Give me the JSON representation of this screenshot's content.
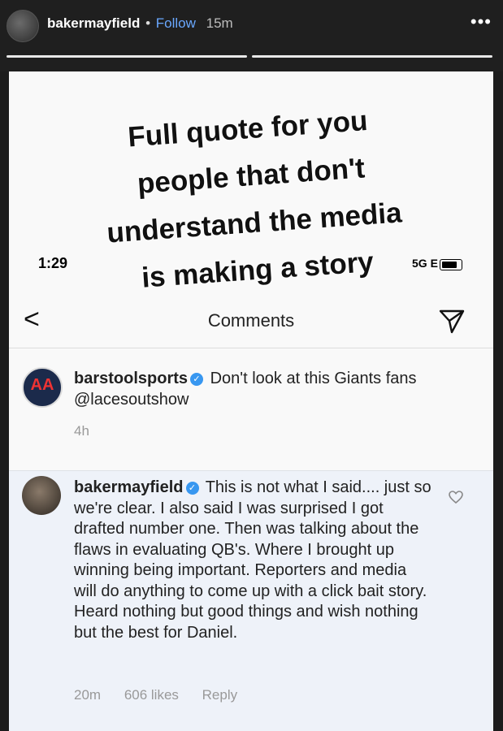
{
  "story": {
    "username": "bakermayfield",
    "separator": "•",
    "follow_label": "Follow",
    "time": "15m",
    "more_label": "•••"
  },
  "overlay": {
    "line1": "Full quote for you",
    "line2": "people that don't",
    "line3": "understand the media",
    "line4": "is making a story"
  },
  "status_bar": {
    "time": "1:29",
    "network": "5G E"
  },
  "nav": {
    "back": "<",
    "title": "Comments"
  },
  "caption": {
    "username": "barstoolsports",
    "text": "Don't look at this Giants fans @lacesoutshow",
    "time": "4h"
  },
  "comment": {
    "username": "bakermayfield",
    "text": "This is not what I said.... just so we're clear. I also said I was surprised I got drafted number one. Then was talking about the flaws in evaluating QB's. Where I brought up winning being important. Reporters and media will do anything to come up with a click bait story. Heard nothing but good things and wish nothing but the best for Daniel.",
    "time": "20m",
    "likes": "606 likes",
    "reply_label": "Reply"
  },
  "icons": {
    "verified": "✓",
    "logo": "AA"
  }
}
